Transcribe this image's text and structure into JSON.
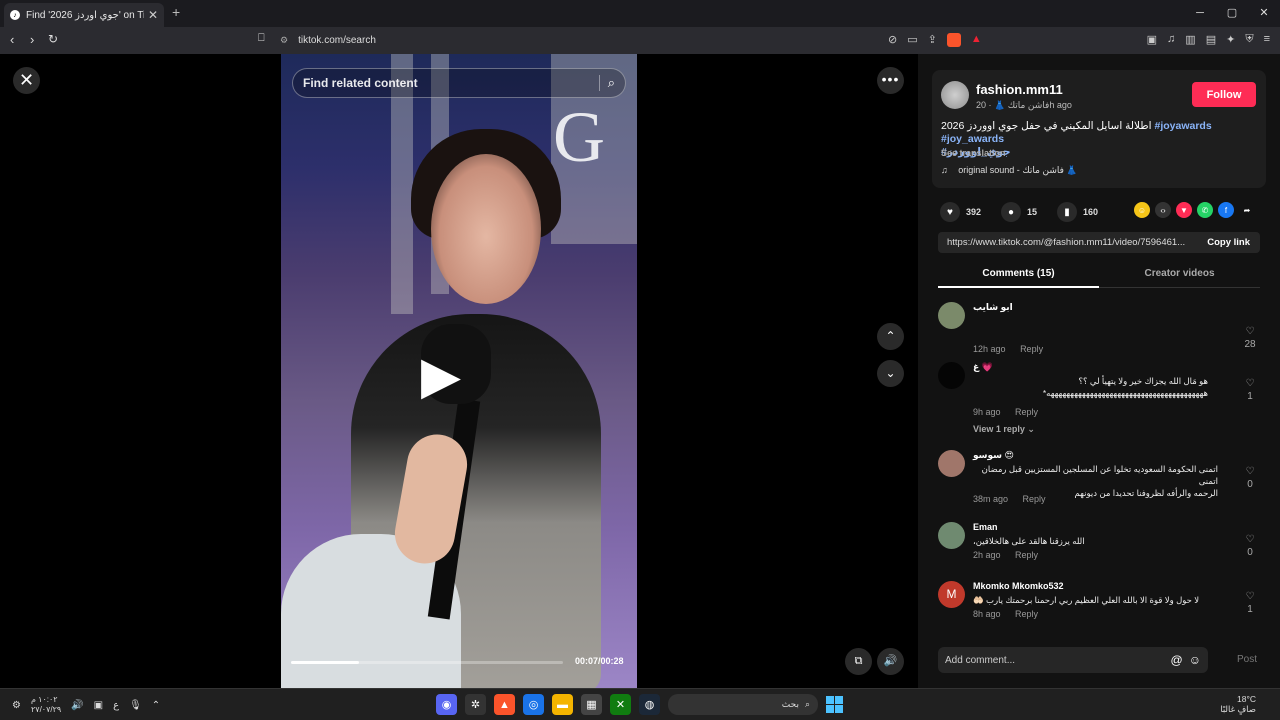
{
  "browser": {
    "tab_title": "Find 'جوي اوردز 2026' on TikTok",
    "url": "tiktok.com/search"
  },
  "video": {
    "search_placeholder": "Find related content",
    "time": "00:07/00:28",
    "progress_percent": 25,
    "logo_letter": "G"
  },
  "post": {
    "author": "fashion.mm11",
    "author_sub": "فاشن ماتك 👗 · 20h ago",
    "follow_label": "Follow",
    "caption_text": "2026 اطلالة اسايل المكيني في حفل جوي اووردز",
    "caption_tags": "#joyawards #joy_awards",
    "caption_tag2": "#جوي_اووردز",
    "see_translation": "See translation",
    "sound": "original sound - فاشن ماتك 👗",
    "likes": "392",
    "comments": "15",
    "saves": "160",
    "link": "https://www.tiktok.com/@fashion.mm11/video/7596461...",
    "copy_link": "Copy link"
  },
  "tabs": {
    "comments": "Comments (15)",
    "creator": "Creator videos"
  },
  "comment_list": [
    {
      "user": "ابو شايب",
      "text": "",
      "time": "12h ago",
      "reply": "Reply",
      "likes": "28"
    },
    {
      "user": "غ 💗",
      "text": "هو مَال الله يجزاك خير ولا يتهيأ لي ؟؟",
      "text2": "ههههههههههههههههههههههههههههههههههههههههه*",
      "time": "9h ago",
      "reply": "Reply",
      "likes": "1",
      "view_reply": "View 1 reply ⌄"
    },
    {
      "user": "سوسو 😍",
      "text": "اتمنى الحكومة السعوديه تخلوا عن المسلجين المستزيين قبل رمضان اتمنى",
      "text2": "الرحمه والرأفه لظروفنا تحديدا من ديونهم",
      "time": "38m ago",
      "reply": "Reply",
      "likes": "0"
    },
    {
      "user": "Eman",
      "text": "الله يرزقنا هالقد على هالخلاقين،",
      "time": "2h ago",
      "reply": "Reply",
      "likes": "0"
    },
    {
      "user": "Mkomko Mkomko532",
      "text": "لا حول ولا قوة الا بالله العلي العظيم ربي ارحمنا برحمتك يارب 🤲🏻",
      "time": "8h ago",
      "reply": "Reply",
      "likes": "1"
    }
  ],
  "composer": {
    "placeholder": "Add comment...",
    "post_label": "Post"
  },
  "taskbar": {
    "clock_time": "١٠:٠٢ م",
    "clock_date": "٢٧/٠٧/٢٩",
    "lang": "ع",
    "search_label": "بحث",
    "weather_temp": "18°C",
    "weather_desc": "صافٍ غالبًا"
  },
  "colors": {
    "follow": "#fe2c55",
    "hashtag": "#8ab4f8",
    "panel_bg": "#121212"
  }
}
